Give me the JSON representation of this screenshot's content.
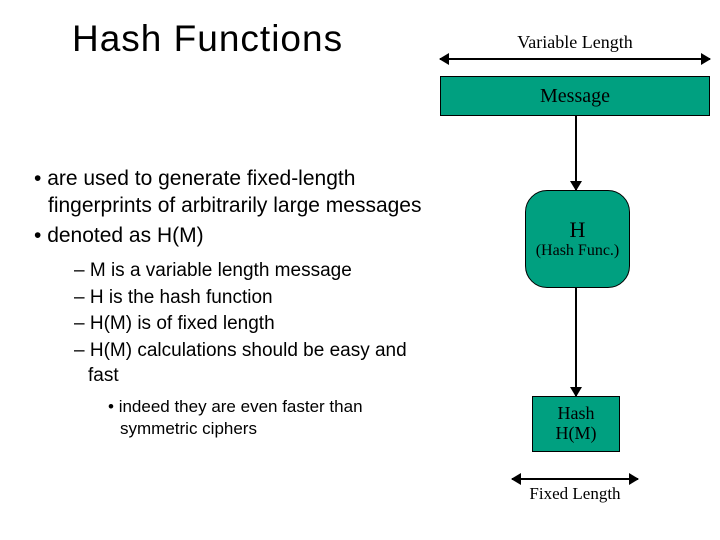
{
  "title": "Hash Functions",
  "bullets": {
    "b1": "are used to generate fixed-length fingerprints of arbitrarily large messages",
    "b2": "denoted as H(M)",
    "sub": {
      "s1": "M is a variable length message",
      "s2": "H is the hash function",
      "s3": "H(M) is of fixed length",
      "s4": "H(M) calculations should be easy and fast"
    },
    "subsub": {
      "t1": "indeed they are even faster than symmetric ciphers"
    }
  },
  "diagram": {
    "variable_length": "Variable Length",
    "message": "Message",
    "hash_func_h": "H",
    "hash_func_sub": "(Hash Func.)",
    "hash_out_1": "Hash",
    "hash_out_2": "H(M)",
    "fixed_length": "Fixed Length"
  },
  "colors": {
    "accent": "#00a080"
  }
}
